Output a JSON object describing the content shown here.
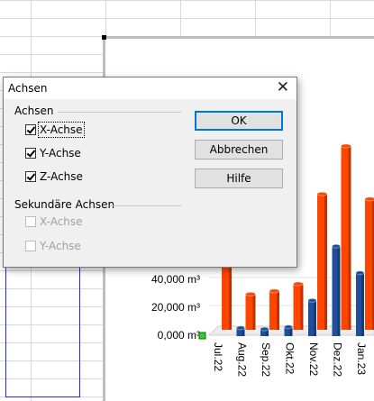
{
  "dialog": {
    "title": "Achsen",
    "close_glyph": "✕",
    "primary_group": {
      "title": "Achsen",
      "items": [
        {
          "label": "X-Achse",
          "checked": true,
          "enabled": true
        },
        {
          "label": "Y-Achse",
          "checked": true,
          "enabled": true
        },
        {
          "label": "Z-Achse",
          "checked": true,
          "enabled": true
        }
      ]
    },
    "secondary_group": {
      "title": "Sekundäre Achsen",
      "items": [
        {
          "label": "X-Achse",
          "checked": false,
          "enabled": false
        },
        {
          "label": "Y-Achse",
          "checked": false,
          "enabled": false
        }
      ]
    },
    "buttons": {
      "ok": "OK",
      "cancel": "Abbrechen",
      "help": "Hilfe"
    }
  },
  "chart_data": {
    "type": "bar",
    "categories": [
      "Jul.22",
      "Aug.22",
      "Sep.22",
      "Okt.22",
      "Nov.22",
      "Dez.22",
      "Jan.23"
    ],
    "y_tick_labels": [
      "0,000 m³",
      "20,000 m³",
      "40,000 m³"
    ],
    "ylim": [
      0,
      240
    ],
    "series": [
      {
        "values": [
          0,
          8,
          7,
          9,
          35,
          88,
          62
        ],
        "color": "#1f4e9c"
      },
      {
        "values": [
          85,
          35,
          38,
          45,
          133,
          180,
          128
        ],
        "color": "#ff4500"
      }
    ]
  }
}
